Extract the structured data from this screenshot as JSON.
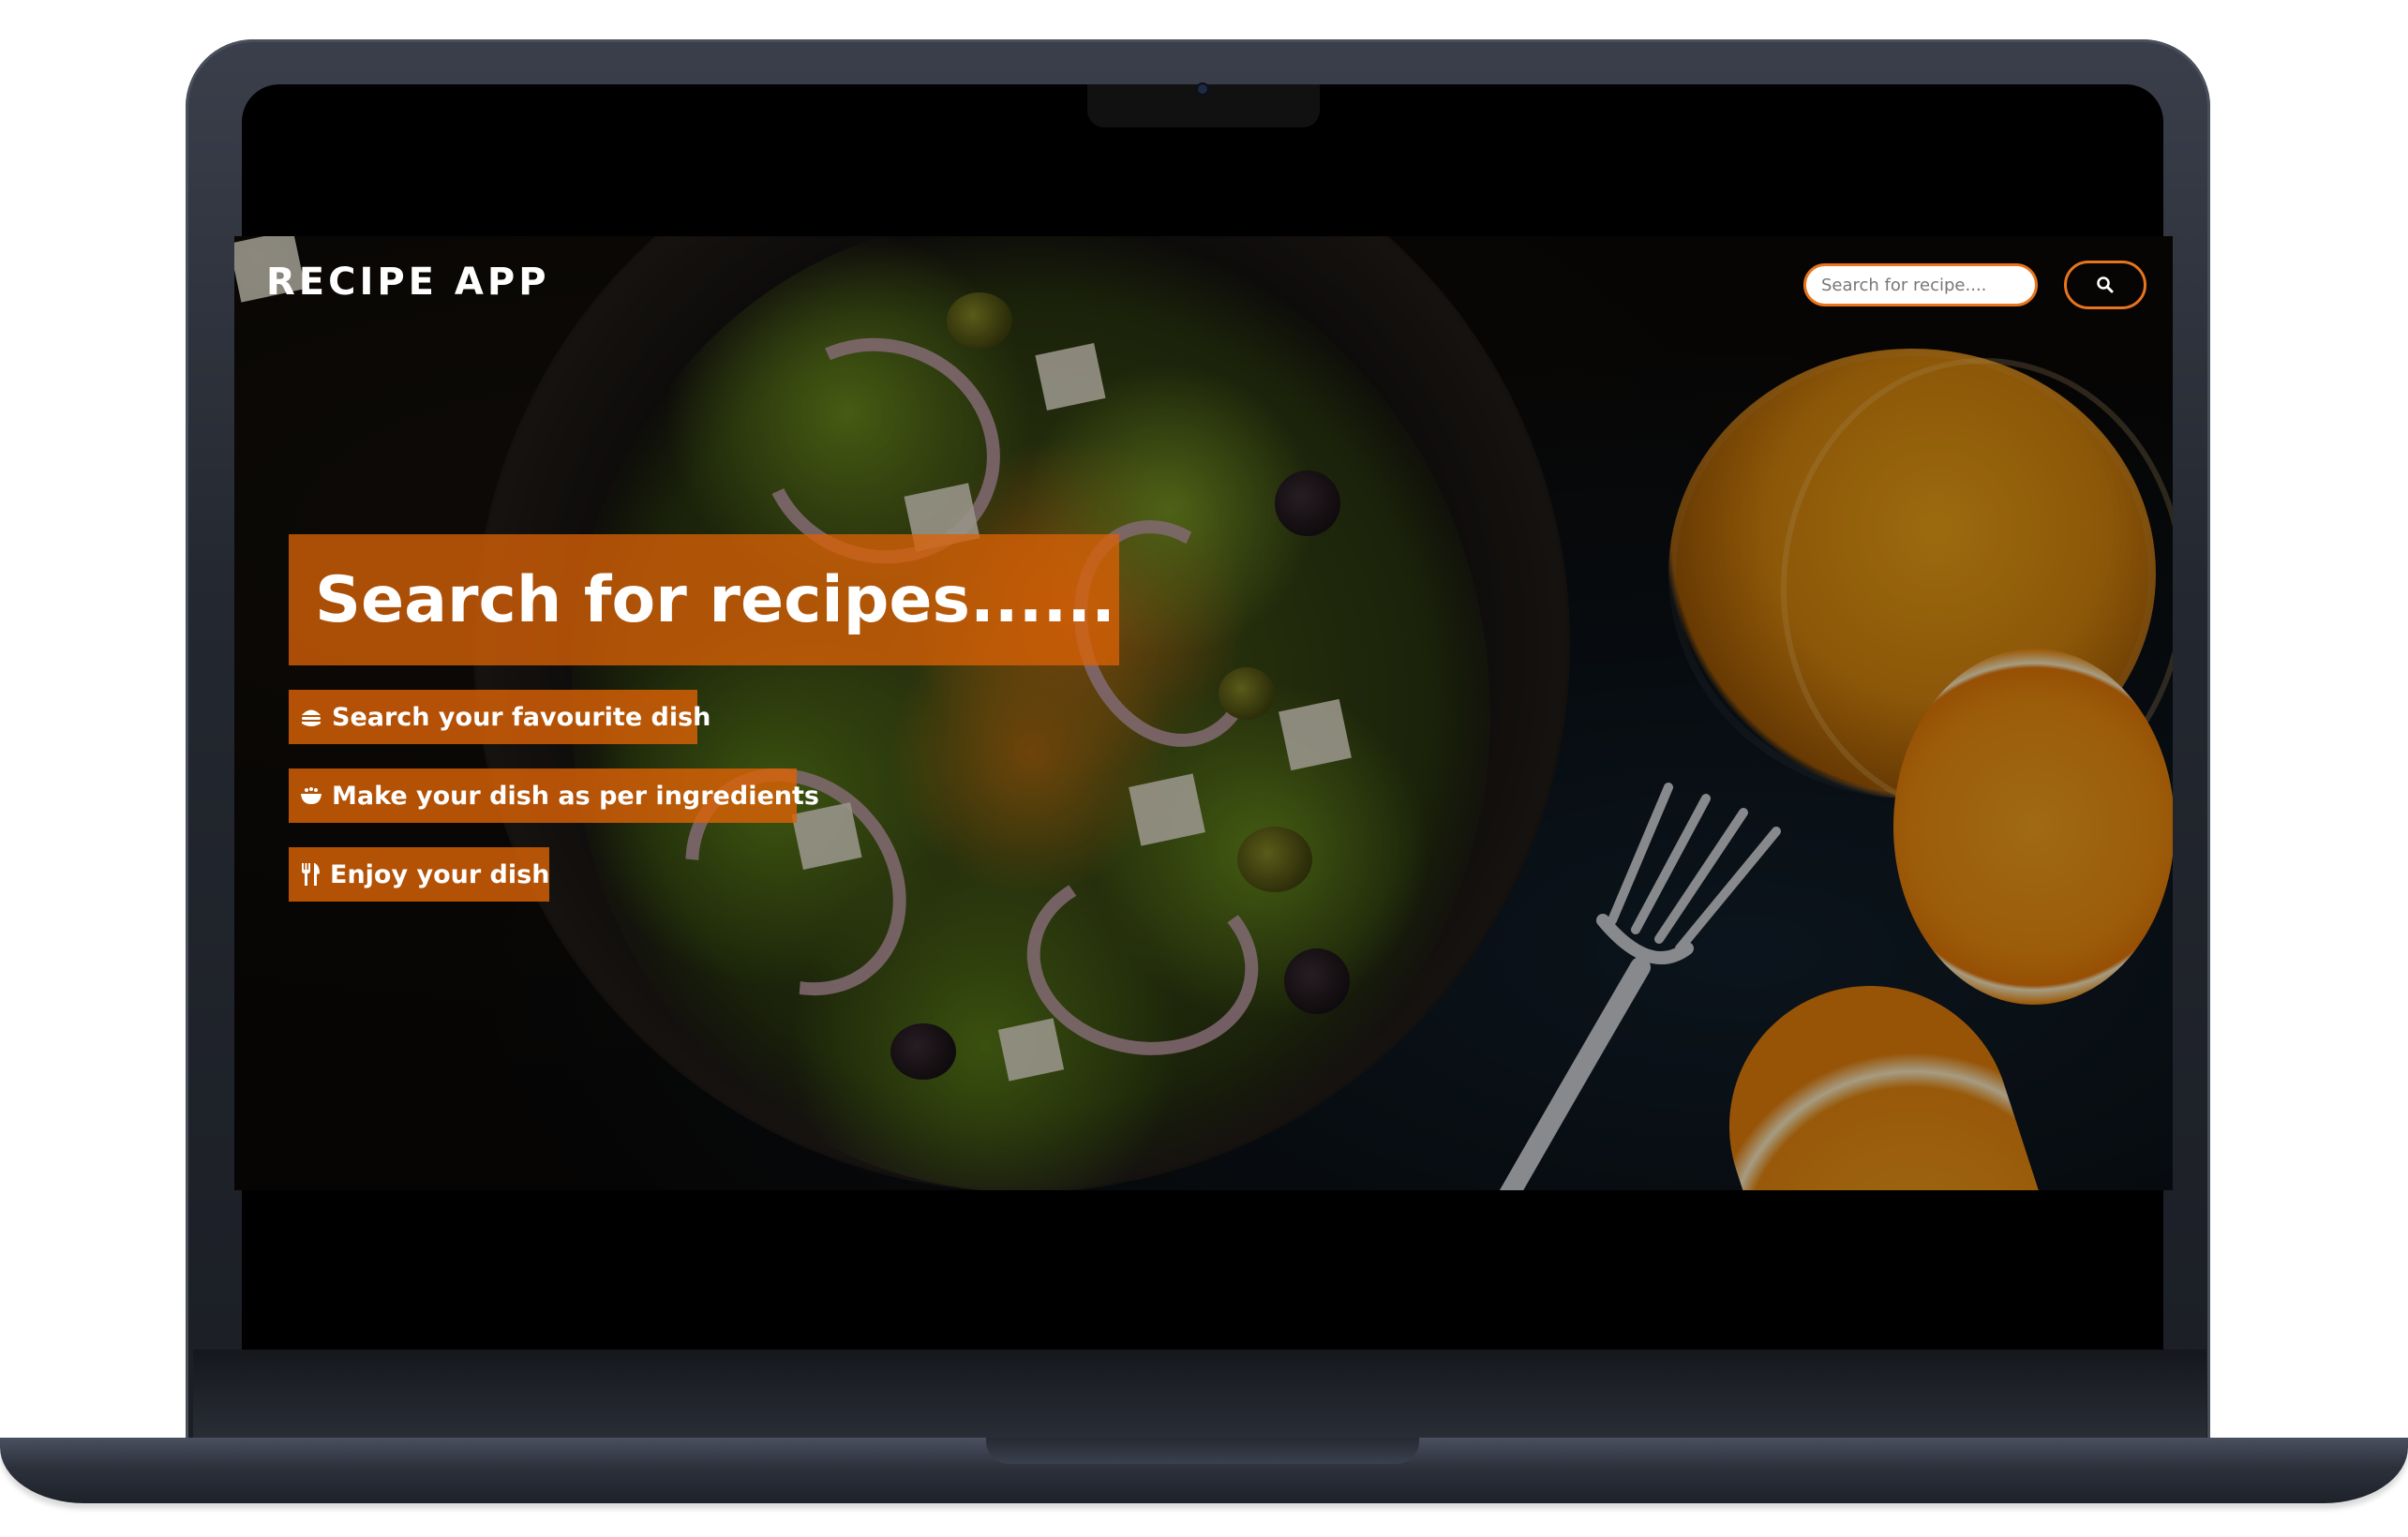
{
  "app": {
    "brand": "RECIPE APP"
  },
  "search": {
    "placeholder": "Search for recipe....",
    "button_icon": "search-icon"
  },
  "hero": {
    "title": "Search for recipes......"
  },
  "features": [
    {
      "icon": "burger-icon",
      "label": "Search your favourite dish"
    },
    {
      "icon": "bowl-icon",
      "label": "Make your dish as per ingredients"
    },
    {
      "icon": "utensils-icon",
      "label": "Enjoy your dish"
    }
  ],
  "colors": {
    "accent": "#d96206",
    "search_border": "#e8741c",
    "text": "#ffffff",
    "laptop_body": "#23272f"
  }
}
